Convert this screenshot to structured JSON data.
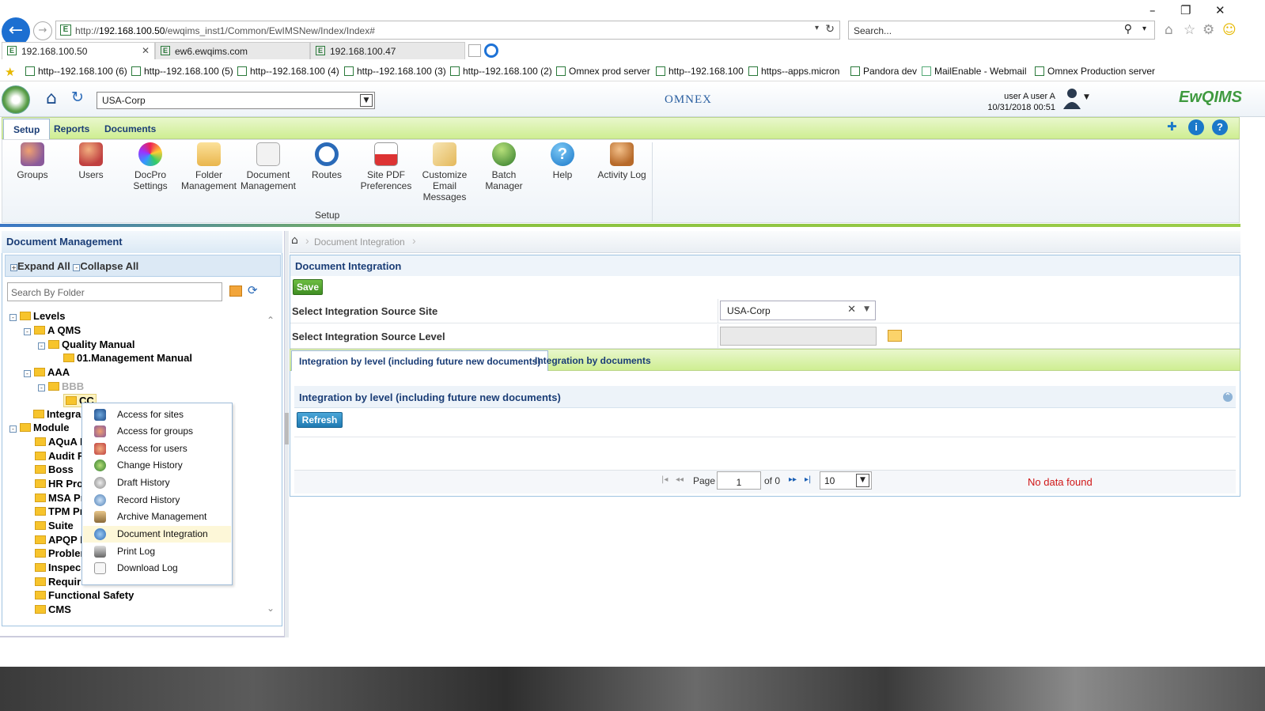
{
  "browser": {
    "url_prefix": "http://",
    "url_host": "192.168.100.50",
    "url_path": "/ewqims_inst1/Common/EwIMSNew/Index/Index#",
    "search_placeholder": "Search...",
    "tabs": [
      {
        "label": "192.168.100.50",
        "active": true
      },
      {
        "label": "ew6.ewqims.com",
        "active": false
      },
      {
        "label": "192.168.100.47",
        "active": false
      }
    ],
    "favorites": [
      "http--192.168.100 (6)",
      "http--192.168.100 (5)",
      "http--192.168.100 (4)",
      "http--192.168.100 (3)",
      "http--192.168.100 (2)",
      "Omnex prod server",
      "http--192.168.100",
      "https--apps.micron",
      "Pandora dev",
      "MailEnable - Webmail",
      "Omnex Production server"
    ]
  },
  "header": {
    "site": "USA-Corp",
    "brand": "OMNEX",
    "user": "user A user A",
    "datetime": "10/31/2018 00:51",
    "app_logo": "EwQIMS"
  },
  "ribbon": {
    "tabs": [
      "Setup",
      "Reports",
      "Documents"
    ],
    "active_tab": "Setup",
    "buttons": [
      {
        "label": "Groups",
        "icon": "groups-icon"
      },
      {
        "label": "Users",
        "icon": "users-icon"
      },
      {
        "label": "DocPro Settings",
        "icon": "docpro-settings-icon"
      },
      {
        "label": "Folder Management",
        "icon": "folder-management-icon"
      },
      {
        "label": "Document Management",
        "icon": "document-management-icon"
      },
      {
        "label": "Routes",
        "icon": "routes-icon"
      },
      {
        "label": "Site PDF Preferences",
        "icon": "pdf-icon"
      },
      {
        "label": "Customize Email Messages",
        "icon": "email-icon"
      },
      {
        "label": "Batch Manager",
        "icon": "batch-icon"
      },
      {
        "label": "Help",
        "icon": "help-icon"
      },
      {
        "label": "Activity Log",
        "icon": "activity-log-icon"
      }
    ],
    "group_label": "Setup"
  },
  "left_panel": {
    "title": "Document Management",
    "expand_all": "Expand All",
    "collapse_all": "Collapse All",
    "search_placeholder": "Search By Folder",
    "tree": [
      {
        "label": "Levels"
      },
      {
        "label": "A QMS"
      },
      {
        "label": "Quality Manual"
      },
      {
        "label": "01.Management Manual"
      },
      {
        "label": "AAA"
      },
      {
        "label": "BBB"
      },
      {
        "label": "CC"
      },
      {
        "label": "Integra"
      },
      {
        "label": "Module"
      },
      {
        "label": "AQuA F"
      },
      {
        "label": "Audit F"
      },
      {
        "label": "Boss"
      },
      {
        "label": "HR Pro"
      },
      {
        "label": "MSA Pr"
      },
      {
        "label": "TPM Pr"
      },
      {
        "label": "Suite"
      },
      {
        "label": "APQP F"
      },
      {
        "label": "Probler"
      },
      {
        "label": "Inspec"
      },
      {
        "label": "Requir"
      },
      {
        "label": "Functional Safety"
      },
      {
        "label": "CMS"
      }
    ]
  },
  "context_menu": {
    "items": [
      "Access for sites",
      "Access for groups",
      "Access for users",
      "Change History",
      "Draft History",
      "Record History",
      "Archive Management",
      "Document Integration",
      "Print Log",
      "Download Log"
    ],
    "highlighted": "Document Integration"
  },
  "main": {
    "breadcrumb": "Document Integration",
    "title": "Document Integration",
    "save_label": "Save",
    "source_site_label": "Select Integration Source Site",
    "source_site_value": "USA-Corp",
    "source_level_label": "Select Integration Source Level",
    "source_level_value": "",
    "tabs": [
      "Integration by level (including future new documents)",
      "Integration by documents"
    ],
    "section_title": "Integration by level (including future new documents)",
    "refresh_label": "Refresh",
    "pager": {
      "page_label": "Page",
      "page_value": "1",
      "of_label": "of 0",
      "page_size": "10",
      "empty_message": "No data found"
    }
  },
  "colors": {
    "accent_green": "#cfee92",
    "navy": "#1a3d76",
    "error_red": "#d01818"
  }
}
